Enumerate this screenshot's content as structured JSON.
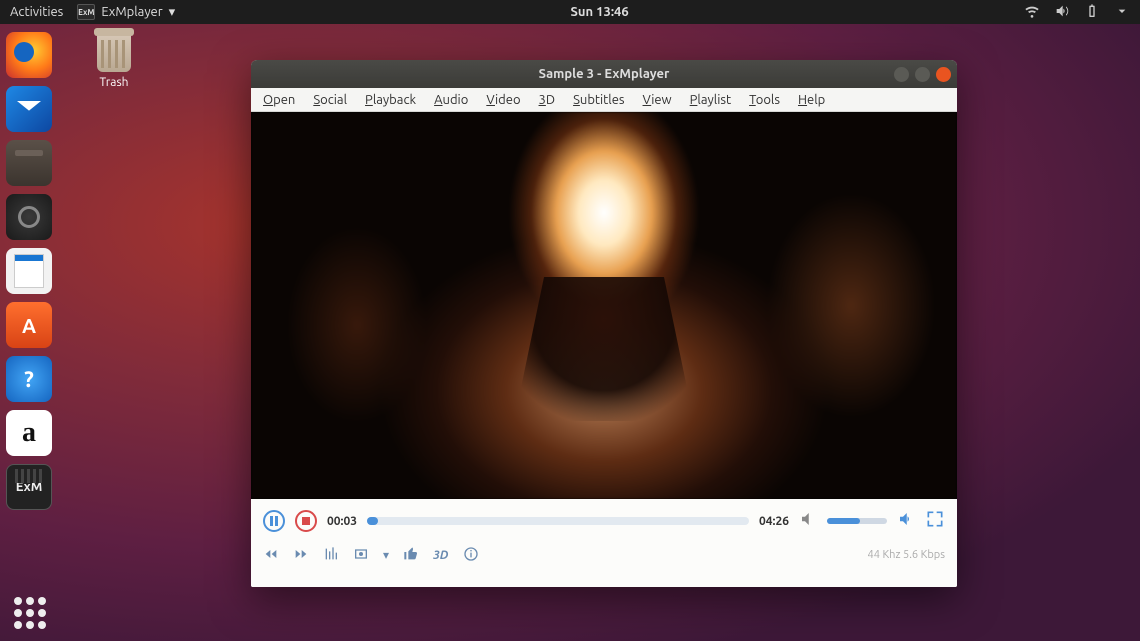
{
  "topbar": {
    "activities": "Activities",
    "app_name": "ExMplayer",
    "clock": "Sun 13:46"
  },
  "desktop": {
    "trash_label": "Trash"
  },
  "player": {
    "title": "Sample 3 - ExMplayer",
    "menu": {
      "open": "Open",
      "social": "Social",
      "playback": "Playback",
      "audio": "Audio",
      "video": "Video",
      "threeD": "3D",
      "subtitles": "Subtitles",
      "view": "View",
      "playlist": "Playlist",
      "tools": "Tools",
      "help": "Help"
    },
    "time_elapsed": "00:03",
    "time_total": "04:26",
    "row2_3d": "3D",
    "status": "44 Khz 5.6 Kbps"
  }
}
